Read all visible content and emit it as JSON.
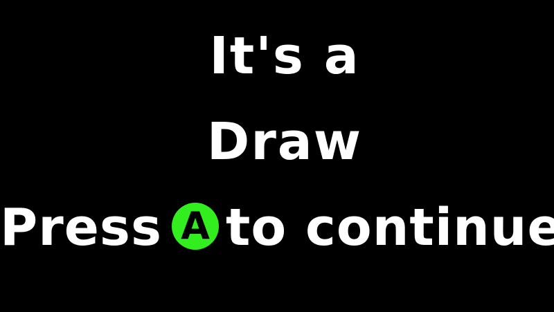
{
  "result": {
    "line1": "It's a",
    "line2": "Draw"
  },
  "prompt": {
    "prefix": "Press",
    "button_label": "A",
    "suffix": "to continue"
  },
  "colors": {
    "background": "#000000",
    "text": "#ffffff",
    "a_button": "#33ee1e",
    "a_button_letter": "#000000"
  },
  "icons": {
    "button": "a-button-icon"
  }
}
